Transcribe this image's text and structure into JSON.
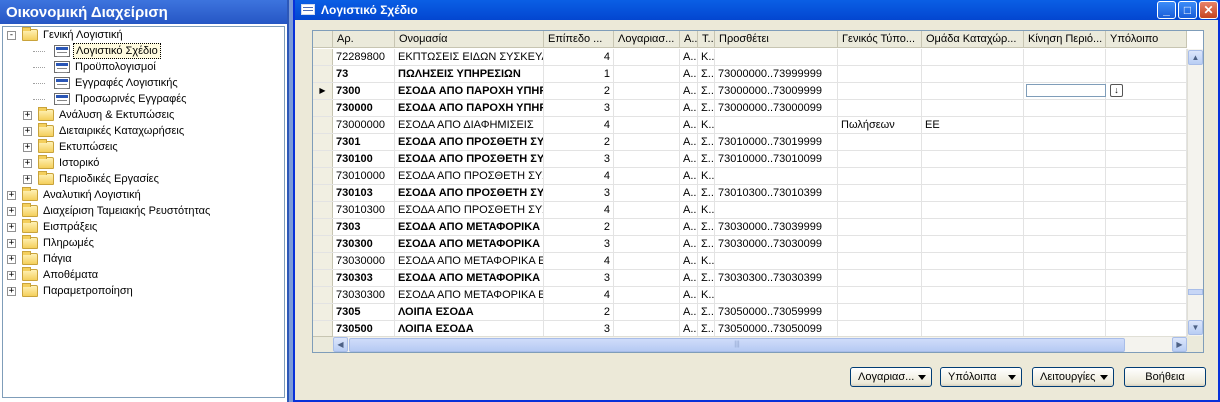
{
  "navigation": {
    "title": "Οικονομική Διαχείριση",
    "tree": [
      {
        "label": "Γενική Λογιστική",
        "level": 0,
        "expander": "-",
        "icon": "folder-icon"
      },
      {
        "label": "Λογιστικό Σχέδιο",
        "level": 2,
        "expander": "",
        "icon": "form-icon",
        "selected": true
      },
      {
        "label": "Προϋπολογισμοί",
        "level": 2,
        "expander": "",
        "icon": "form-icon"
      },
      {
        "label": "Εγγραφές Λογιστικής",
        "level": 2,
        "expander": "",
        "icon": "form-icon"
      },
      {
        "label": "Προσωρινές Εγγραφές",
        "level": 2,
        "expander": "",
        "icon": "form-icon"
      },
      {
        "label": "Ανάλυση & Εκτυπώσεις",
        "level": 1,
        "expander": "+",
        "icon": "folder-icon"
      },
      {
        "label": "Διεταιρικές Καταχωρήσεις",
        "level": 1,
        "expander": "+",
        "icon": "folder-icon"
      },
      {
        "label": "Εκτυπώσεις",
        "level": 1,
        "expander": "+",
        "icon": "folder-icon"
      },
      {
        "label": "Ιστορικό",
        "level": 1,
        "expander": "+",
        "icon": "folder-icon"
      },
      {
        "label": "Περιοδικές Εργασίες",
        "level": 1,
        "expander": "+",
        "icon": "folder-icon"
      },
      {
        "label": "Αναλυτική Λογιστική",
        "level": 0,
        "expander": "+",
        "icon": "folder-icon"
      },
      {
        "label": "Διαχείριση Ταμειακής Ρευστότητας",
        "level": 0,
        "expander": "+",
        "icon": "folder-icon"
      },
      {
        "label": "Εισπράξεις",
        "level": 0,
        "expander": "+",
        "icon": "folder-icon"
      },
      {
        "label": "Πληρωμές",
        "level": 0,
        "expander": "+",
        "icon": "folder-icon"
      },
      {
        "label": "Πάγια",
        "level": 0,
        "expander": "+",
        "icon": "folder-icon"
      },
      {
        "label": "Αποθέματα",
        "level": 0,
        "expander": "+",
        "icon": "folder-icon"
      },
      {
        "label": "Παραμετροποίηση",
        "level": 0,
        "expander": "+",
        "icon": "folder-icon"
      }
    ]
  },
  "window": {
    "title": "Λογιστικό Σχέδιο",
    "minimize_label": "_",
    "maximize_label": "□",
    "close_label": "✕"
  },
  "grid": {
    "columns": [
      "Αρ.",
      "Ονομασία",
      "Επίπεδο ...",
      "Λογαριασ...",
      "Α...",
      "Τ...",
      "Προσθέτει",
      "Γενικός Τύπο...",
      "Ομάδα Καταχώρ...",
      "Κίνηση Περιό...",
      "Υπόλοιπο"
    ],
    "current_row": 2,
    "rows": [
      {
        "no": "72289800",
        "name": "ΕΚΠΤΩΣΕΙΣ ΕΙΔΩΝ ΣΥΣΚΕΥΑΣΙΑΣ",
        "level": "4",
        "a": "Α...",
        "t": "Κ...",
        "totaling": "",
        "gen_type": "",
        "group": "",
        "bold": false
      },
      {
        "no": "73",
        "name": "ΠΩΛΗΣΕΙΣ ΥΠΗΡΕΣΙΩΝ",
        "level": "1",
        "a": "Α...",
        "t": "Σ...",
        "totaling": "73000000..73999999",
        "gen_type": "",
        "group": "",
        "bold": true
      },
      {
        "no": "7300",
        "name": "ΕΣΟΔΑ ΑΠΟ ΠΑΡΟΧΗ ΥΠΗΡ...",
        "level": "2",
        "a": "Α...",
        "t": "Σ...",
        "totaling": "73000000..73009999",
        "gen_type": "",
        "group": "",
        "bold": true
      },
      {
        "no": "730000",
        "name": "ΕΣΟΔΑ ΑΠΟ ΠΑΡΟΧΗ ΥΠΗΡ...",
        "level": "3",
        "a": "Α...",
        "t": "Σ...",
        "totaling": "73000000..73000099",
        "gen_type": "",
        "group": "",
        "bold": true
      },
      {
        "no": "73000000",
        "name": "ΕΣΟΔΑ ΑΠΟ ΔΙΑΦΗΜΙΣΕΙΣ",
        "level": "4",
        "a": "Α...",
        "t": "Κ...",
        "totaling": "",
        "gen_type": "Πωλήσεων",
        "group": "ΕΕ",
        "bold": false
      },
      {
        "no": "7301",
        "name": "ΕΣΟΔΑ ΑΠΟ ΠΡΟΣΘΕΤΗ ΣΥΣ...",
        "level": "2",
        "a": "Α...",
        "t": "Σ...",
        "totaling": "73010000..73019999",
        "gen_type": "",
        "group": "",
        "bold": true
      },
      {
        "no": "730100",
        "name": "ΕΣΟΔΑ ΑΠΟ ΠΡΟΣΘΕΤΗ ΣΥΣ...",
        "level": "3",
        "a": "Α...",
        "t": "Σ...",
        "totaling": "73010000..73010099",
        "gen_type": "",
        "group": "",
        "bold": true
      },
      {
        "no": "73010000",
        "name": "ΕΣΟΔΑ ΑΠΟ ΠΡΟΣΘΕΤΗ ΣΥΣΚ...",
        "level": "4",
        "a": "Α...",
        "t": "Κ...",
        "totaling": "",
        "gen_type": "",
        "group": "",
        "bold": false
      },
      {
        "no": "730103",
        "name": "ΕΣΟΔΑ ΑΠΟ ΠΡΟΣΘΕΤΗ ΣΥΣ...",
        "level": "3",
        "a": "Α...",
        "t": "Σ...",
        "totaling": "73010300..73010399",
        "gen_type": "",
        "group": "",
        "bold": true
      },
      {
        "no": "73010300",
        "name": "ΕΣΟΔΑ ΑΠΟ ΠΡΟΣΘΕΤΗ ΣΥΣΚ...",
        "level": "4",
        "a": "Α...",
        "t": "Κ...",
        "totaling": "",
        "gen_type": "",
        "group": "",
        "bold": false
      },
      {
        "no": "7303",
        "name": "ΕΣΟΔΑ ΑΠΟ ΜΕΤΑΦΟΡΙΚΑ",
        "level": "2",
        "a": "Α...",
        "t": "Σ...",
        "totaling": "73030000..73039999",
        "gen_type": "",
        "group": "",
        "bold": true
      },
      {
        "no": "730300",
        "name": "ΕΣΟΔΑ ΑΠΟ ΜΕΤΑΦΟΡΙΚΑ ...",
        "level": "3",
        "a": "Α...",
        "t": "Σ...",
        "totaling": "73030000..73030099",
        "gen_type": "",
        "group": "",
        "bold": true
      },
      {
        "no": "73030000",
        "name": "ΕΣΟΔΑ ΑΠΟ ΜΕΤΑΦΟΡΙΚΑ ΕΣ...",
        "level": "4",
        "a": "Α...",
        "t": "Κ...",
        "totaling": "",
        "gen_type": "",
        "group": "",
        "bold": false
      },
      {
        "no": "730303",
        "name": "ΕΣΟΔΑ ΑΠΟ ΜΕΤΑΦΟΡΙΚΑ ...",
        "level": "3",
        "a": "Α...",
        "t": "Σ...",
        "totaling": "73030300..73030399",
        "gen_type": "",
        "group": "",
        "bold": true
      },
      {
        "no": "73030300",
        "name": "ΕΣΟΔΑ ΑΠΟ ΜΕΤΑΦΟΡΙΚΑ ΕΞ...",
        "level": "4",
        "a": "Α...",
        "t": "Κ...",
        "totaling": "",
        "gen_type": "",
        "group": "",
        "bold": false
      },
      {
        "no": "7305",
        "name": "ΛΟΙΠΑ ΕΣΟΔΑ",
        "level": "2",
        "a": "Α...",
        "t": "Σ...",
        "totaling": "73050000..73059999",
        "gen_type": "",
        "group": "",
        "bold": true
      },
      {
        "no": "730500",
        "name": "ΛΟΙΠΑ ΕΣΟΔΑ",
        "level": "3",
        "a": "Α...",
        "t": "Σ...",
        "totaling": "73050000..73050099",
        "gen_type": "",
        "group": "",
        "bold": true
      }
    ]
  },
  "buttons": {
    "accounts": "Λογαριασ...",
    "balances": "Υπόλοιπα",
    "functions": "Λειτουργίες",
    "help": "Βοήθεια"
  }
}
